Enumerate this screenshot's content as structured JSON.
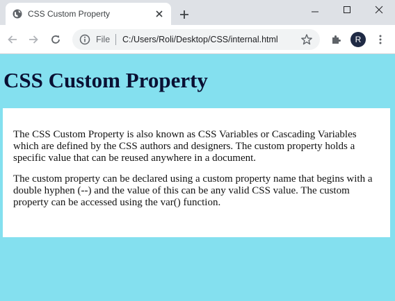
{
  "browser": {
    "tab": {
      "title": "CSS Custom Property"
    },
    "address_bar": {
      "scheme_label": "File",
      "url": "C:/Users/Roli/Desktop/CSS/internal.html"
    },
    "profile_initial": "R"
  },
  "page": {
    "heading": "CSS Custom Property",
    "paragraphs": [
      "The CSS Custom Property is also known as CSS Variables or Cascading Variables which are defined by the CSS authors and designers. The custom property holds a specific value that can be reused anywhere in a document.",
      "The custom property can be declared using a custom property name that begins with a double hyphen (--) and the value of this can be any valid CSS value. The custom property can be accessed using the var() function."
    ]
  },
  "colors": {
    "page_background": "#84e0ef",
    "content_background": "#ffffff",
    "heading_text": "#0a1033",
    "tab_strip": "#dee1e6"
  },
  "icons": {
    "favicon": "globe-icon",
    "tab_close": "close-icon",
    "new_tab": "plus-icon",
    "back": "arrow-left-icon",
    "forward": "arrow-right-icon",
    "reload": "reload-icon",
    "site_info": "info-icon",
    "bookmark": "star-icon",
    "extensions": "puzzle-icon",
    "menu": "kebab-menu-icon"
  }
}
